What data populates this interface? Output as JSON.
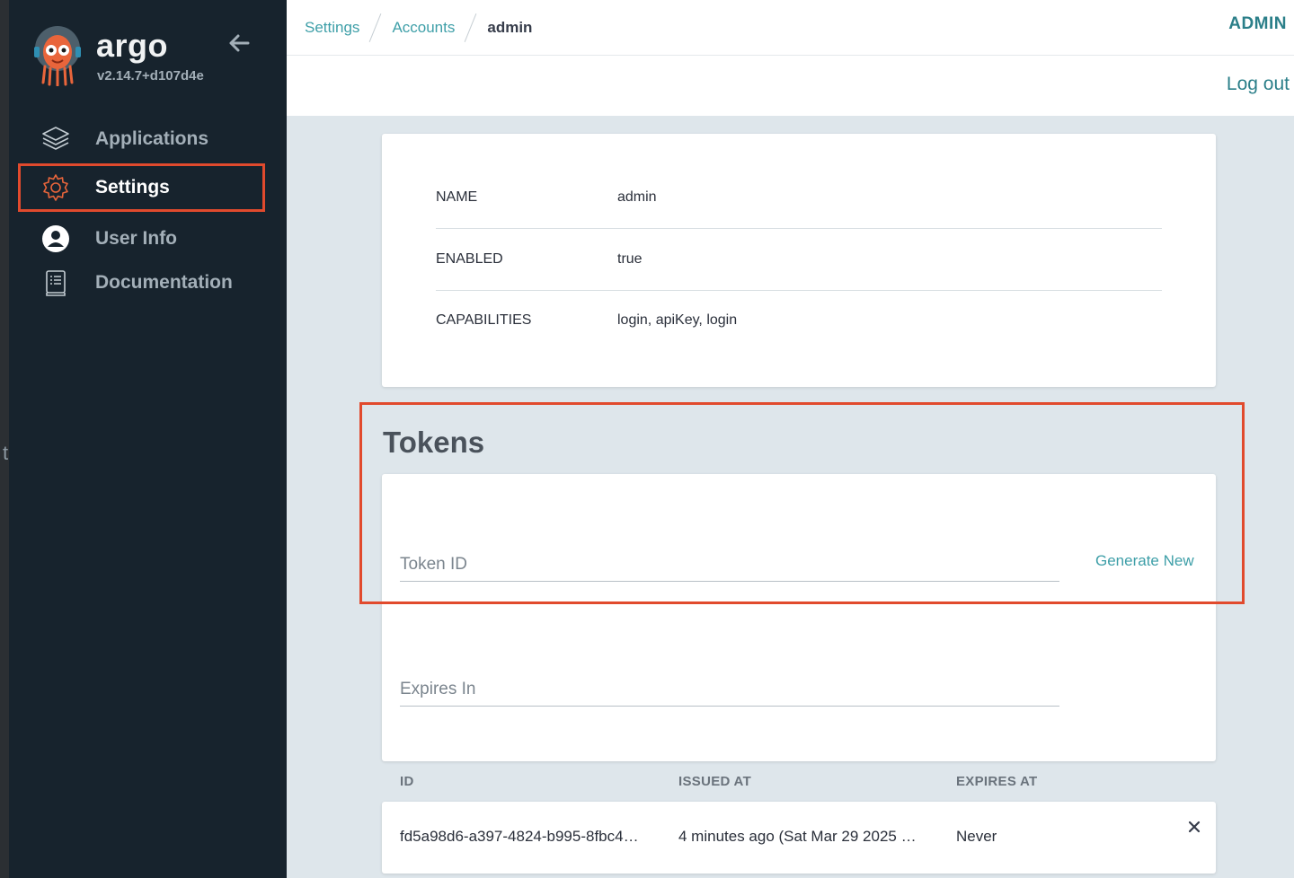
{
  "sidebar": {
    "brand": "argo",
    "version": "v2.14.7+d107d4e",
    "items": [
      {
        "label": "Applications"
      },
      {
        "label": "Settings"
      },
      {
        "label": "User Info"
      },
      {
        "label": "Documentation"
      }
    ]
  },
  "topbar": {
    "breadcrumbs": [
      "Settings",
      "Accounts",
      "admin"
    ],
    "user": "ADMIN",
    "logout": "Log out"
  },
  "account": {
    "rows": [
      {
        "key": "NAME",
        "value": "admin"
      },
      {
        "key": "ENABLED",
        "value": "true"
      },
      {
        "key": "CAPABILITIES",
        "value": "login, apiKey, login"
      }
    ]
  },
  "tokens": {
    "title": "Tokens",
    "token_id_placeholder": "Token ID",
    "expires_in_placeholder": "Expires In",
    "generate_label": "Generate New",
    "columns": [
      "ID",
      "ISSUED AT",
      "EXPIRES AT"
    ],
    "rows": [
      {
        "id": "fd5a98d6-a397-4824-b995-8fbc4…",
        "issued_at": "4 minutes ago (Sat Mar 29 2025 …",
        "expires_at": "Never"
      }
    ]
  },
  "colors": {
    "sidebar_bg": "#17232d",
    "accent": "#3e9fa8",
    "highlight": "#e14a2d",
    "content_bg": "#dee6eb"
  }
}
